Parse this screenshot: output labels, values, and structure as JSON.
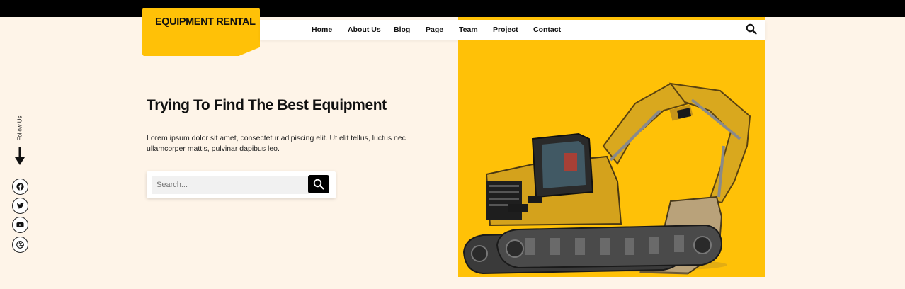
{
  "logo": {
    "text": "EQUIPMENT RENTAL"
  },
  "nav": {
    "items": [
      {
        "label": "Home"
      },
      {
        "label": "About Us"
      },
      {
        "label": "Blog"
      },
      {
        "label": "Page"
      },
      {
        "label": "Team"
      },
      {
        "label": "Project"
      },
      {
        "label": "Contact"
      }
    ],
    "search_icon": "search-icon"
  },
  "hero": {
    "title": "Trying To Find The Best Equipment",
    "description": "Lorem ipsum dolor sit amet, consectetur adipiscing elit. Ut elit tellus, luctus nec ullamcorper mattis, pulvinar dapibus leo.",
    "image": "excavator"
  },
  "search": {
    "placeholder": "Search...",
    "value": "",
    "button_icon": "search-icon"
  },
  "sidebar": {
    "follow_label": "Follow Us",
    "icons": [
      "facebook-icon",
      "twitter-icon",
      "youtube-icon",
      "dribbble-icon"
    ]
  },
  "colors": {
    "accent": "#ffc107",
    "background": "#fef4e8",
    "topbar": "#000000"
  }
}
